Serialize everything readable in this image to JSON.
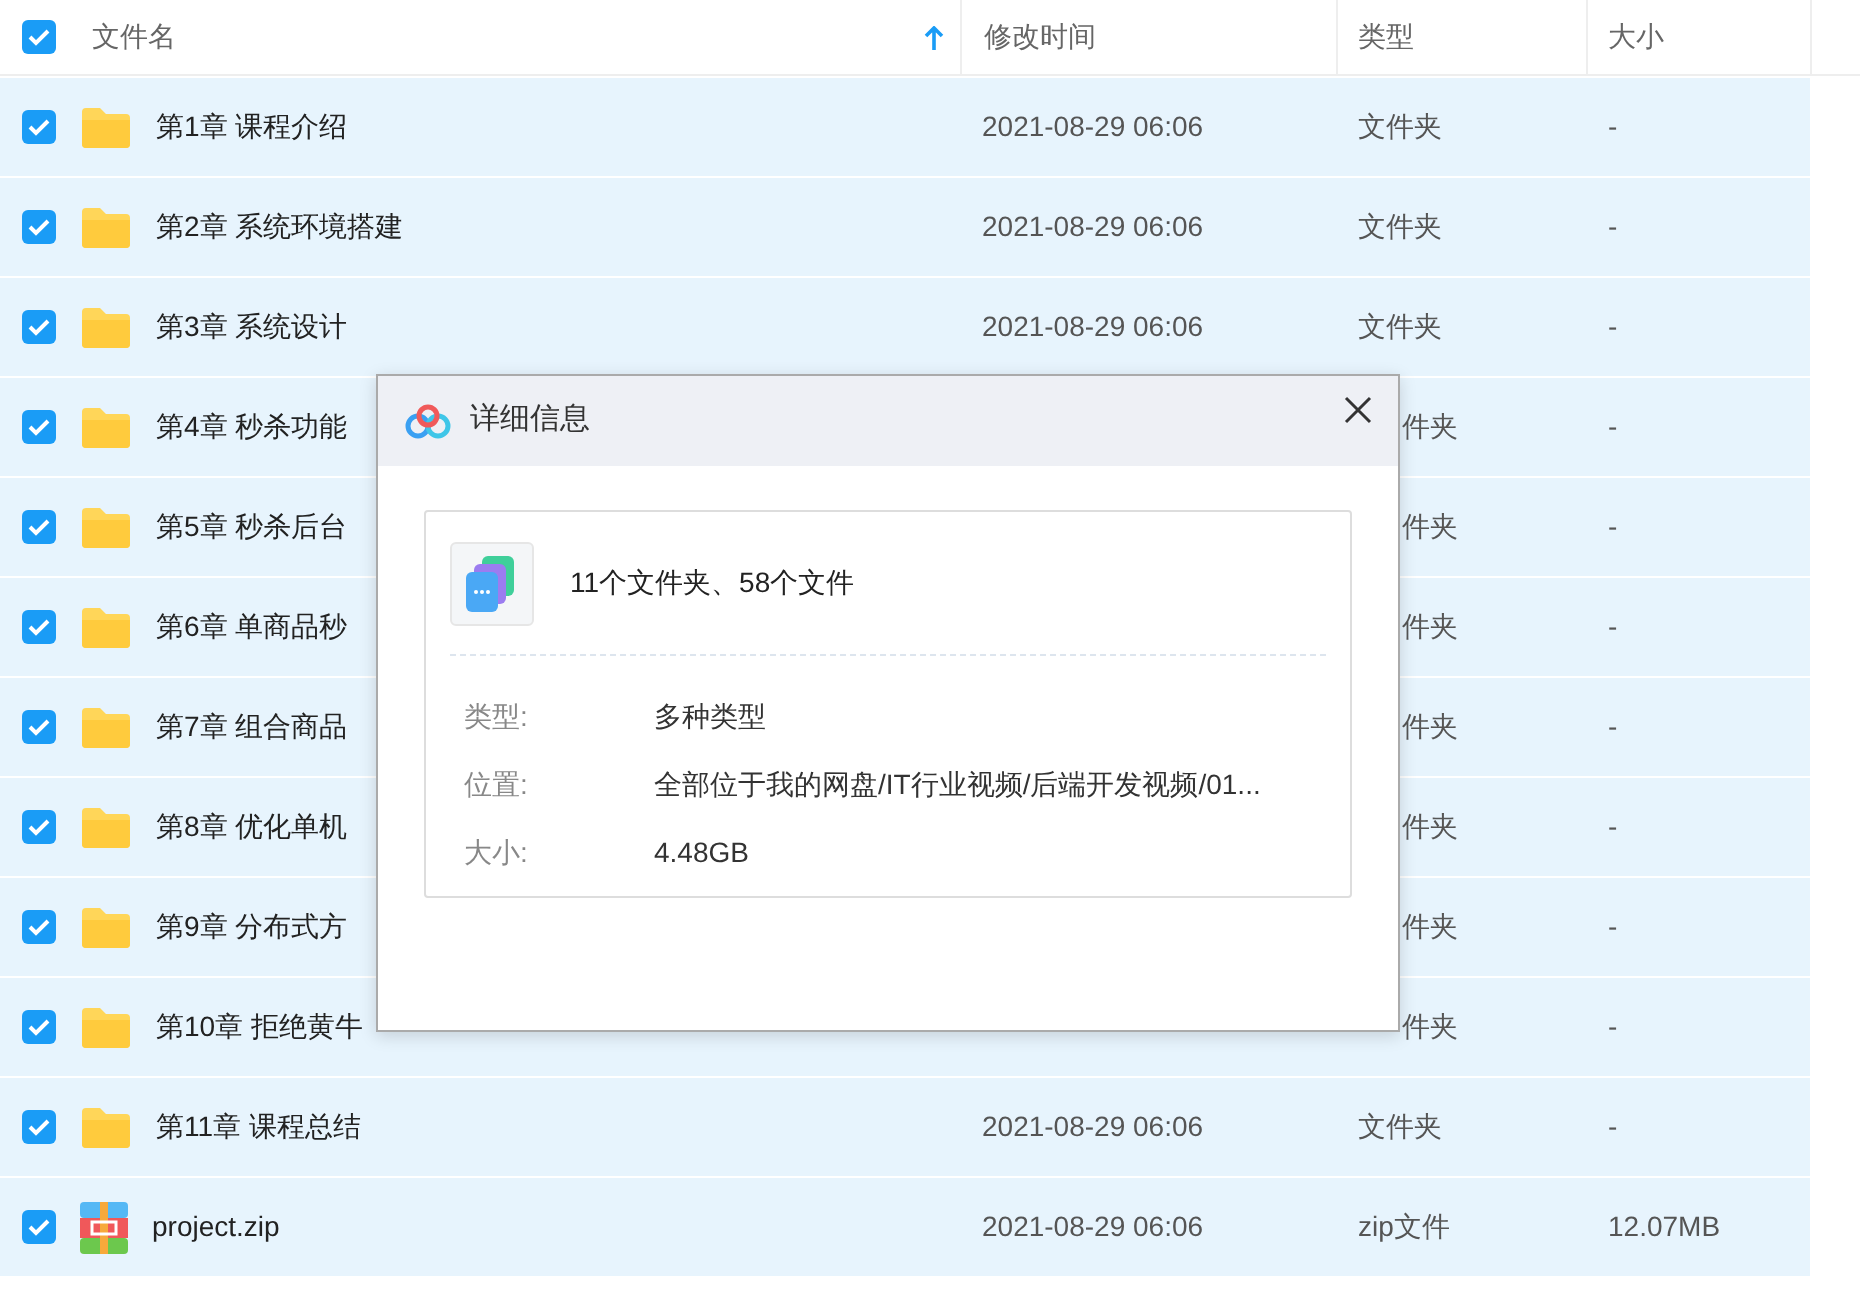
{
  "table": {
    "all_checked": true,
    "columns": [
      {
        "label": "文件名",
        "sorted": true
      },
      {
        "label": "修改时间",
        "sorted": false
      },
      {
        "label": "类型",
        "sorted": false
      },
      {
        "label": "大小",
        "sorted": false
      }
    ],
    "rows": [
      {
        "kind": "folder",
        "checked": true,
        "name": "第1章 课程介绍",
        "date": "2021-08-29 06:06",
        "type": "文件夹",
        "size": "-"
      },
      {
        "kind": "folder",
        "checked": true,
        "name": "第2章 系统环境搭建",
        "date": "2021-08-29 06:06",
        "type": "文件夹",
        "size": "-"
      },
      {
        "kind": "folder",
        "checked": true,
        "name": "第3章 系统设计",
        "date": "2021-08-29 06:06",
        "type": "文件夹",
        "size": "-"
      },
      {
        "kind": "folder",
        "checked": true,
        "name": "第4章 秒杀功能",
        "type_tail": "件夹",
        "size": "-"
      },
      {
        "kind": "folder",
        "checked": true,
        "name": "第5章 秒杀后台",
        "type_tail": "件夹",
        "size": "-"
      },
      {
        "kind": "folder",
        "checked": true,
        "name": "第6章 单商品秒",
        "type_tail": "件夹",
        "size": "-"
      },
      {
        "kind": "folder",
        "checked": true,
        "name": "第7章 组合商品",
        "type_tail": "件夹",
        "size": "-"
      },
      {
        "kind": "folder",
        "checked": true,
        "name": "第8章 优化单机",
        "type_tail": "件夹",
        "size": "-"
      },
      {
        "kind": "folder",
        "checked": true,
        "name": "第9章 分布式方",
        "type_tail": "件夹",
        "size": "-"
      },
      {
        "kind": "folder",
        "checked": true,
        "name": "第10章 拒绝黄牛",
        "type_tail": "件夹",
        "size": "-"
      },
      {
        "kind": "folder",
        "checked": true,
        "name": "第11章 课程总结",
        "date": "2021-08-29 06:06",
        "type": "文件夹",
        "size": "-"
      },
      {
        "kind": "zip",
        "checked": true,
        "name": "project.zip",
        "date": "2021-08-29 06:06",
        "type": "zip文件",
        "size": "12.07MB"
      }
    ]
  },
  "dialog": {
    "title": "详细信息",
    "summary": "11个文件夹、58个文件",
    "fields": [
      {
        "label": "类型:",
        "value": "多种类型"
      },
      {
        "label": "位置:",
        "value": "全部位于我的网盘/IT行业视频/后端开发视频/01..."
      },
      {
        "label": "大小:",
        "value": "4.48GB"
      }
    ]
  }
}
